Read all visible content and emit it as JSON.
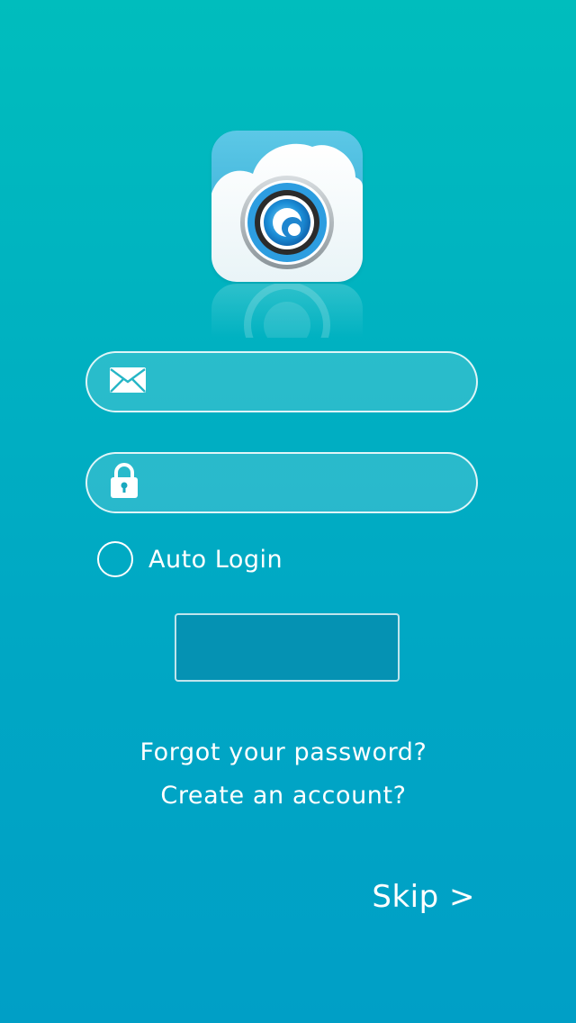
{
  "app": {
    "logo_icon": "camera-cloud-icon"
  },
  "login_form": {
    "email": {
      "icon": "envelope-icon",
      "value": "",
      "placeholder": ""
    },
    "password": {
      "icon": "lock-icon",
      "value": "",
      "placeholder": ""
    },
    "auto_login_label": "Auto Login",
    "auto_login_checked": false,
    "login_button_label": ""
  },
  "links": {
    "forgot_password": "Forgot your password?",
    "create_account": "Create an account?",
    "skip": "Skip >"
  },
  "colors": {
    "background_top": "#00bdbd",
    "background_bottom": "#009fc6",
    "button_fill": "#0592b3",
    "text": "#ffffff"
  }
}
